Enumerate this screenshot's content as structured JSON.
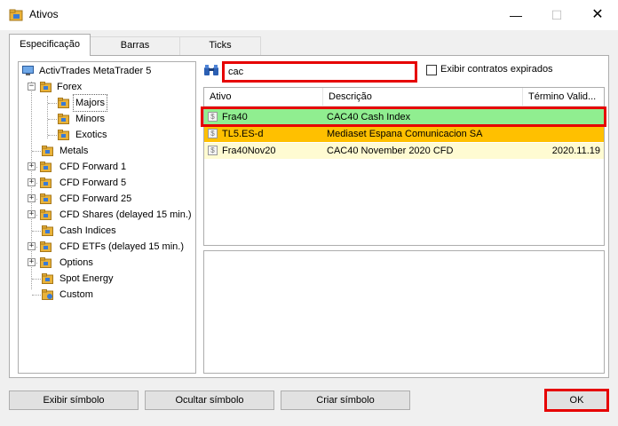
{
  "window": {
    "title": "Ativos",
    "minimize_glyph": "—",
    "maximize_glyph": "☐",
    "close_glyph": "✕"
  },
  "tabs": [
    {
      "label": "Especificação",
      "active": true
    },
    {
      "label": "Barras",
      "active": false
    },
    {
      "label": "Ticks",
      "active": false
    }
  ],
  "tree": {
    "root": "ActivTrades MetaTrader 5",
    "items": [
      {
        "label": "Forex",
        "expanded": true
      },
      {
        "label": "Majors",
        "selected": true
      },
      {
        "label": "Minors"
      },
      {
        "label": "Exotics"
      },
      {
        "label": "Metals"
      },
      {
        "label": "CFD Forward 1"
      },
      {
        "label": "CFD Forward 5"
      },
      {
        "label": "CFD Forward 25"
      },
      {
        "label": "CFD Shares (delayed 15 min.)"
      },
      {
        "label": "Cash Indices"
      },
      {
        "label": "CFD ETFs (delayed 15 min.)"
      },
      {
        "label": "Options"
      },
      {
        "label": "Spot Energy"
      },
      {
        "label": "Custom"
      }
    ]
  },
  "search": {
    "value": "cac",
    "checkbox_label": "Exibir contratos expirados",
    "checkbox_checked": false
  },
  "table": {
    "columns": [
      "Ativo",
      "Descrição",
      "Término Valid..."
    ],
    "rows": [
      {
        "symbol": "Fra40",
        "description": "CAC40 Cash Index",
        "expiry": "",
        "color": "#90ee90"
      },
      {
        "symbol": "TL5.ES-d",
        "description": "Mediaset Espana Comunicacion SA",
        "expiry": "",
        "color": "#ffc000"
      },
      {
        "symbol": "Fra40Nov20",
        "description": "CAC40 November 2020 CFD",
        "expiry": "2020.11.19",
        "color": "#fffbd2"
      }
    ]
  },
  "buttons": {
    "show": "Exibir símbolo",
    "hide": "Ocultar símbolo",
    "create": "Criar símbolo",
    "ok": "OK"
  },
  "colors": {
    "highlight_red": "#e60000"
  }
}
